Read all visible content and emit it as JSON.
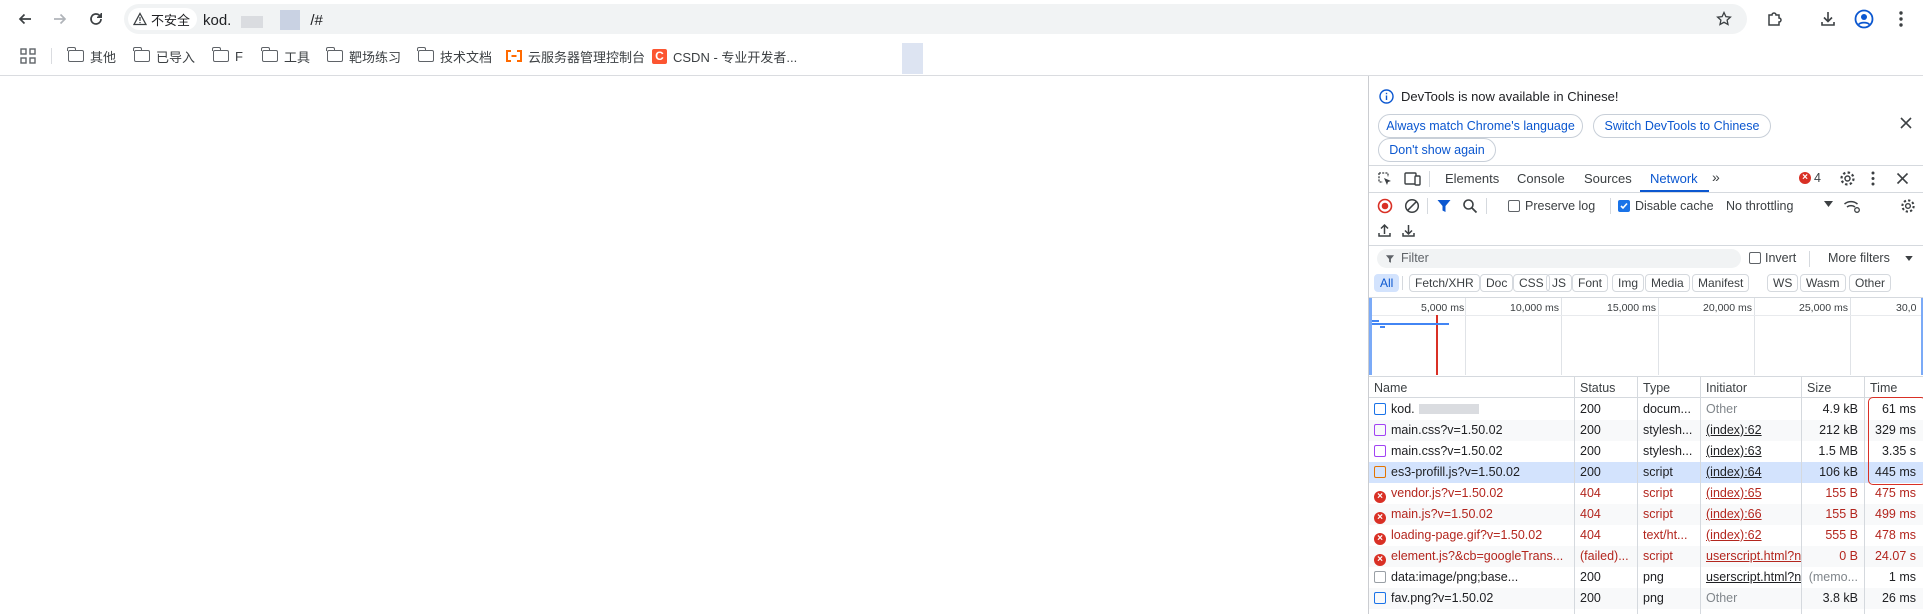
{
  "browser": {
    "security_chip": "不安全",
    "url_prefix": "kod.",
    "url_suffix": "/#"
  },
  "bookmarks": [
    {
      "label": "其他",
      "icon": "folder-icon"
    },
    {
      "label": "已导入",
      "icon": "folder-icon"
    },
    {
      "label": "F",
      "icon": "folder-icon"
    },
    {
      "label": "工具",
      "icon": "folder-icon"
    },
    {
      "label": "靶场练习",
      "icon": "folder-icon"
    },
    {
      "label": "技术文档",
      "icon": "folder-icon"
    },
    {
      "label": "云服务器管理控制台",
      "icon": "aliyun-icon"
    },
    {
      "label": "CSDN - 专业开发者...",
      "icon": "csdn-icon"
    }
  ],
  "devtools": {
    "banner_text": "DevTools is now available in Chinese!",
    "btn_match": "Always match Chrome's language",
    "btn_switch": "Switch DevTools to Chinese",
    "btn_dont_show": "Don't show again",
    "tabs": [
      "Elements",
      "Console",
      "Sources",
      "Network"
    ],
    "active_tab": "Network",
    "error_count": "4",
    "preserve_log": "Preserve log",
    "disable_cache": "Disable cache",
    "throttling": "No throttling",
    "filter_placeholder": "Filter",
    "invert": "Invert",
    "more_filters": "More filters",
    "filter_types": [
      "All",
      "Fetch/XHR",
      "Doc",
      "CSS",
      "JS",
      "Font",
      "Img",
      "Media",
      "Manifest",
      "WS",
      "Wasm",
      "Other"
    ],
    "timeline_labels": [
      "5,000 ms",
      "10,000 ms",
      "15,000 ms",
      "20,000 ms",
      "25,000 ms",
      "30,0"
    ],
    "columns": [
      "Name",
      "Status",
      "Type",
      "Initiator",
      "Size",
      "Time"
    ],
    "requests": [
      {
        "name": "kod.",
        "status": "200",
        "type": "docum...",
        "initiator": "Other",
        "size": "4.9 kB",
        "time": "61 ms",
        "kind": "doc",
        "error": false,
        "redacted": true
      },
      {
        "name": "main.css?v=1.50.02",
        "status": "200",
        "type": "stylesh...",
        "initiator": "(index):62",
        "size": "212 kB",
        "time": "329 ms",
        "kind": "css",
        "error": false
      },
      {
        "name": "main.css?v=1.50.02",
        "status": "200",
        "type": "stylesh...",
        "initiator": "(index):63",
        "size": "1.5 MB",
        "time": "3.35 s",
        "kind": "css",
        "error": false
      },
      {
        "name": "es3-profill.js?v=1.50.02",
        "status": "200",
        "type": "script",
        "initiator": "(index):64",
        "size": "106 kB",
        "time": "445 ms",
        "kind": "js",
        "error": false,
        "selected": true
      },
      {
        "name": "vendor.js?v=1.50.02",
        "status": "404",
        "type": "script",
        "initiator": "(index):65",
        "size": "155 B",
        "time": "475 ms",
        "kind": "err",
        "error": true
      },
      {
        "name": "main.js?v=1.50.02",
        "status": "404",
        "type": "script",
        "initiator": "(index):66",
        "size": "155 B",
        "time": "499 ms",
        "kind": "err",
        "error": true
      },
      {
        "name": "loading-page.gif?v=1.50.02",
        "status": "404",
        "type": "text/ht...",
        "initiator": "(index):62",
        "size": "555 B",
        "time": "478 ms",
        "kind": "err",
        "error": true
      },
      {
        "name": "element.js?&cb=googleTrans...",
        "status": "(failed)...",
        "type": "script",
        "initiator": "userscript.html?n",
        "size": "0 B",
        "time": "24.07 s",
        "kind": "err",
        "error": true
      },
      {
        "name": "data:image/png;base...",
        "status": "200",
        "type": "png",
        "initiator": "userscript.html?n",
        "size": "(memo...",
        "time": "1 ms",
        "kind": "data",
        "error": false
      },
      {
        "name": "fav.png?v=1.50.02",
        "status": "200",
        "type": "png",
        "initiator": "Other",
        "size": "3.8 kB",
        "time": "26 ms",
        "kind": "img",
        "error": false
      }
    ]
  }
}
